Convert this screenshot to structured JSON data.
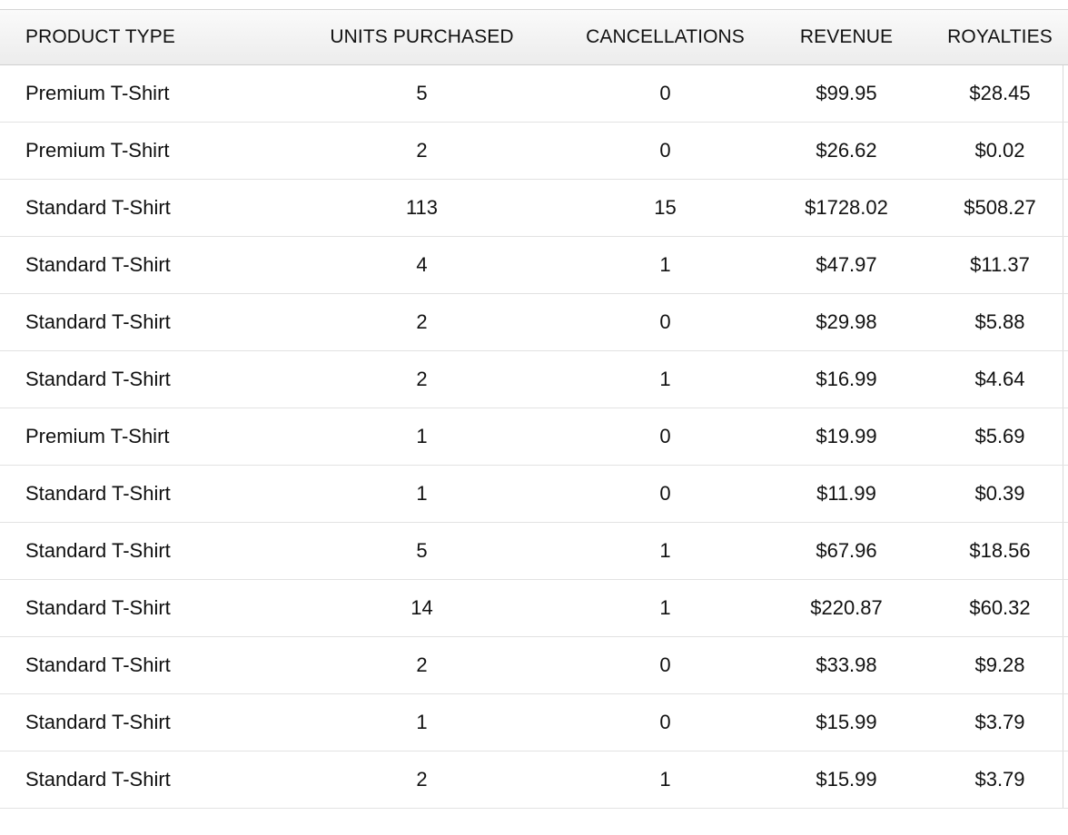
{
  "table": {
    "columns": [
      "PRODUCT TYPE",
      "UNITS PURCHASED",
      "CANCELLATIONS",
      "REVENUE",
      "ROYALTIES"
    ],
    "rows": [
      [
        "Premium T-Shirt",
        "5",
        "0",
        "$99.95",
        "$28.45"
      ],
      [
        "Premium T-Shirt",
        "2",
        "0",
        "$26.62",
        "$0.02"
      ],
      [
        "Standard T-Shirt",
        "113",
        "15",
        "$1728.02",
        "$508.27"
      ],
      [
        "Standard T-Shirt",
        "4",
        "1",
        "$47.97",
        "$11.37"
      ],
      [
        "Standard T-Shirt",
        "2",
        "0",
        "$29.98",
        "$5.88"
      ],
      [
        "Standard T-Shirt",
        "2",
        "1",
        "$16.99",
        "$4.64"
      ],
      [
        "Premium T-Shirt",
        "1",
        "0",
        "$19.99",
        "$5.69"
      ],
      [
        "Standard T-Shirt",
        "1",
        "0",
        "$11.99",
        "$0.39"
      ],
      [
        "Standard T-Shirt",
        "5",
        "1",
        "$67.96",
        "$18.56"
      ],
      [
        "Standard T-Shirt",
        "14",
        "1",
        "$220.87",
        "$60.32"
      ],
      [
        "Standard T-Shirt",
        "2",
        "0",
        "$33.98",
        "$9.28"
      ],
      [
        "Standard T-Shirt",
        "1",
        "0",
        "$15.99",
        "$3.79"
      ],
      [
        "Standard T-Shirt",
        "2",
        "1",
        "$15.99",
        "$3.79"
      ]
    ]
  }
}
